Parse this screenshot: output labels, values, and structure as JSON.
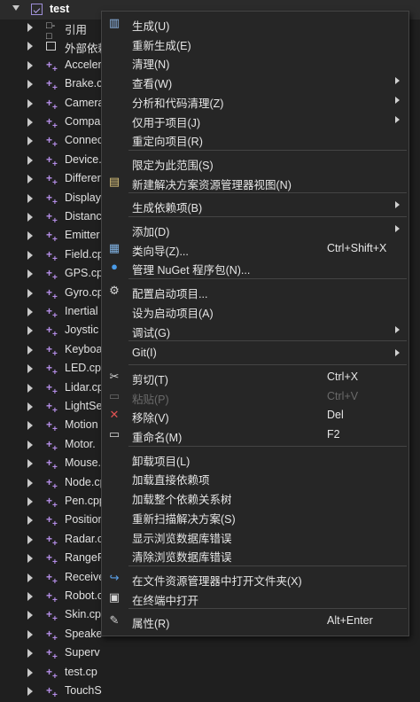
{
  "tree": {
    "project": "test",
    "items": [
      {
        "label": "引用",
        "icon": "references-icon"
      },
      {
        "label": "外部依赖",
        "icon": "external-dependencies-icon"
      },
      {
        "label": "Acceler",
        "icon": "cpp-file-icon"
      },
      {
        "label": "Brake.c",
        "icon": "cpp-file-icon"
      },
      {
        "label": "Camera",
        "icon": "cpp-file-icon"
      },
      {
        "label": "Compa",
        "icon": "cpp-file-icon"
      },
      {
        "label": "Connec",
        "icon": "cpp-file-icon"
      },
      {
        "label": "Device.",
        "icon": "cpp-file-icon"
      },
      {
        "label": "Differer",
        "icon": "cpp-file-icon"
      },
      {
        "label": "Display",
        "icon": "cpp-file-icon"
      },
      {
        "label": "Distanc",
        "icon": "cpp-file-icon"
      },
      {
        "label": "Emitter",
        "icon": "cpp-file-icon"
      },
      {
        "label": "Field.cp",
        "icon": "cpp-file-icon"
      },
      {
        "label": "GPS.cp",
        "icon": "cpp-file-icon"
      },
      {
        "label": "Gyro.cp",
        "icon": "cpp-file-icon"
      },
      {
        "label": "Inertial",
        "icon": "cpp-file-icon"
      },
      {
        "label": "Joystic",
        "icon": "cpp-file-icon"
      },
      {
        "label": "Keyboa",
        "icon": "cpp-file-icon"
      },
      {
        "label": "LED.cpp",
        "icon": "cpp-file-icon"
      },
      {
        "label": "Lidar.cp",
        "icon": "cpp-file-icon"
      },
      {
        "label": "LightSe",
        "icon": "cpp-file-icon"
      },
      {
        "label": "Motion",
        "icon": "cpp-file-icon"
      },
      {
        "label": "Motor.",
        "icon": "cpp-file-icon"
      },
      {
        "label": "Mouse.",
        "icon": "cpp-file-icon"
      },
      {
        "label": "Node.cp",
        "icon": "cpp-file-icon"
      },
      {
        "label": "Pen.cpp",
        "icon": "cpp-file-icon"
      },
      {
        "label": "Position",
        "icon": "cpp-file-icon"
      },
      {
        "label": "Radar.c",
        "icon": "cpp-file-icon"
      },
      {
        "label": "RangeF",
        "icon": "cpp-file-icon"
      },
      {
        "label": "Receive",
        "icon": "cpp-file-icon"
      },
      {
        "label": "Robot.c",
        "icon": "cpp-file-icon"
      },
      {
        "label": "Skin.cp",
        "icon": "cpp-file-icon"
      },
      {
        "label": "Speake",
        "icon": "cpp-file-icon"
      },
      {
        "label": "Superv",
        "icon": "cpp-file-icon"
      },
      {
        "label": "test.cp",
        "icon": "cpp-file-icon"
      },
      {
        "label": "TouchS",
        "icon": "cpp-file-icon"
      }
    ]
  },
  "menu": {
    "items": [
      {
        "label": "生成(U)",
        "icon": "build-icon",
        "shortcut": "",
        "submenu": false,
        "disabled": false
      },
      {
        "label": "重新生成(E)",
        "icon": "",
        "shortcut": "",
        "submenu": false,
        "disabled": false
      },
      {
        "label": "清理(N)",
        "icon": "",
        "shortcut": "",
        "submenu": false,
        "disabled": false
      },
      {
        "label": "查看(W)",
        "icon": "",
        "shortcut": "",
        "submenu": true,
        "disabled": false
      },
      {
        "label": "分析和代码清理(Z)",
        "icon": "",
        "shortcut": "",
        "submenu": true,
        "disabled": false
      },
      {
        "label": "仅用于项目(J)",
        "icon": "",
        "shortcut": "",
        "submenu": true,
        "disabled": false
      },
      {
        "label": "重定向项目(R)",
        "icon": "",
        "shortcut": "",
        "submenu": false,
        "disabled": false
      },
      {
        "sep": true
      },
      {
        "label": "限定为此范围(S)",
        "icon": "",
        "shortcut": "",
        "submenu": false,
        "disabled": false
      },
      {
        "label": "新建解决方案资源管理器视图(N)",
        "icon": "new-view-icon",
        "shortcut": "",
        "submenu": false,
        "disabled": false
      },
      {
        "sep": true
      },
      {
        "label": "生成依赖项(B)",
        "icon": "",
        "shortcut": "",
        "submenu": true,
        "disabled": false
      },
      {
        "sep": true
      },
      {
        "label": "添加(D)",
        "icon": "",
        "shortcut": "",
        "submenu": true,
        "disabled": false
      },
      {
        "label": "类向导(Z)...",
        "icon": "class-wizard-icon",
        "shortcut": "Ctrl+Shift+X",
        "submenu": false,
        "disabled": false
      },
      {
        "label": "管理 NuGet 程序包(N)...",
        "icon": "nuget-icon",
        "shortcut": "",
        "submenu": false,
        "disabled": false
      },
      {
        "sep": true
      },
      {
        "label": "配置启动项目...",
        "icon": "gear-icon",
        "shortcut": "",
        "submenu": false,
        "disabled": false
      },
      {
        "label": "设为启动项目(A)",
        "icon": "",
        "shortcut": "",
        "submenu": false,
        "disabled": false
      },
      {
        "label": "调试(G)",
        "icon": "",
        "shortcut": "",
        "submenu": true,
        "disabled": false
      },
      {
        "sep": true
      },
      {
        "label": "Git(I)",
        "icon": "",
        "shortcut": "",
        "submenu": true,
        "disabled": false
      },
      {
        "sep": true
      },
      {
        "label": "剪切(T)",
        "icon": "scissors-icon",
        "shortcut": "Ctrl+X",
        "submenu": false,
        "disabled": false
      },
      {
        "label": "粘贴(P)",
        "icon": "paste-icon",
        "shortcut": "Ctrl+V",
        "submenu": false,
        "disabled": true
      },
      {
        "label": "移除(V)",
        "icon": "remove-icon",
        "shortcut": "Del",
        "submenu": false,
        "disabled": false
      },
      {
        "label": "重命名(M)",
        "icon": "rename-icon",
        "shortcut": "F2",
        "submenu": false,
        "disabled": false
      },
      {
        "sep": true
      },
      {
        "label": "卸载项目(L)",
        "icon": "",
        "shortcut": "",
        "submenu": false,
        "disabled": false
      },
      {
        "label": "加载直接依赖项",
        "icon": "",
        "shortcut": "",
        "submenu": false,
        "disabled": false
      },
      {
        "label": "加载整个依赖关系树",
        "icon": "",
        "shortcut": "",
        "submenu": false,
        "disabled": false
      },
      {
        "label": "重新扫描解决方案(S)",
        "icon": "",
        "shortcut": "",
        "submenu": false,
        "disabled": false
      },
      {
        "label": "显示浏览数据库错误",
        "icon": "",
        "shortcut": "",
        "submenu": false,
        "disabled": false
      },
      {
        "label": "清除浏览数据库错误",
        "icon": "",
        "shortcut": "",
        "submenu": false,
        "disabled": false
      },
      {
        "sep": true
      },
      {
        "label": "在文件资源管理器中打开文件夹(X)",
        "icon": "open-folder-icon",
        "shortcut": "",
        "submenu": false,
        "disabled": false
      },
      {
        "label": "在终端中打开",
        "icon": "terminal-icon",
        "shortcut": "",
        "submenu": false,
        "disabled": false
      },
      {
        "sep": true
      },
      {
        "label": "属性(R)",
        "icon": "wrench-icon",
        "shortcut": "Alt+Enter",
        "submenu": false,
        "disabled": false
      }
    ]
  },
  "colors": {
    "accent": "#b58ee8",
    "remove": "#e05252",
    "nuget": "#4a9be8",
    "open": "#5aa0e8"
  }
}
